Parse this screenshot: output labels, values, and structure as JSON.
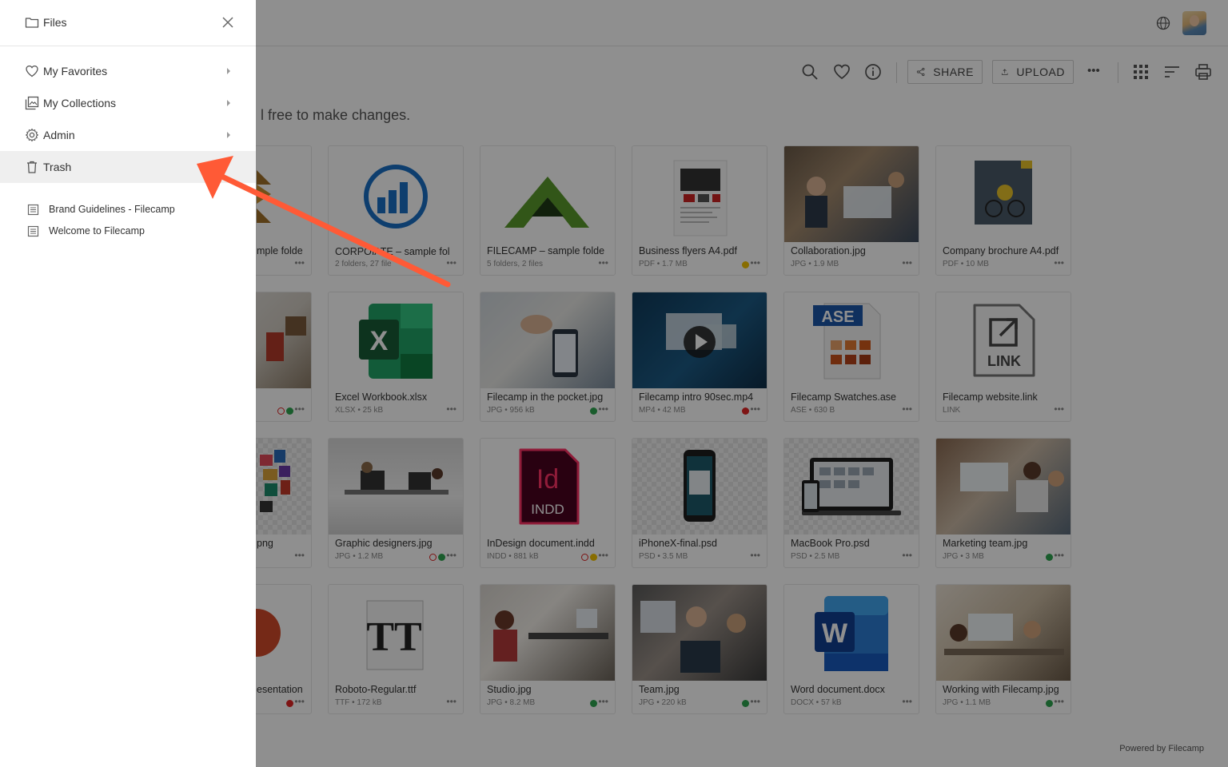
{
  "drawer": {
    "title": "Files",
    "nav": [
      {
        "label": "My Favorites",
        "icon": "heart-icon"
      },
      {
        "label": "My Collections",
        "icon": "collections-icon"
      },
      {
        "label": "Admin",
        "icon": "gear-icon"
      },
      {
        "label": "Trash",
        "icon": "trash-icon"
      }
    ],
    "links": [
      {
        "label": "Brand Guidelines - Filecamp",
        "icon": "document-icon"
      },
      {
        "label": "Welcome to Filecamp",
        "icon": "document-icon"
      }
    ]
  },
  "toolbar": {
    "share_label": "SHARE",
    "upload_label": "UPLOAD",
    "more_label": "•••"
  },
  "notice": "l free to make changes.",
  "tiles": [
    {
      "name": "mple folde",
      "meta": ""
    },
    {
      "name": "CORPOⅰATE – sample fol",
      "meta": "2 folders, 27 file"
    },
    {
      "name": "FILECAMP – sample folde",
      "meta": "5 folders, 2 files"
    },
    {
      "name": "Business flyers A4.pdf",
      "meta": "PDF • 1.7 MB"
    },
    {
      "name": "Collaboration.jpg",
      "meta": "JPG • 1.9 MB"
    },
    {
      "name": "Company brochure A4.pdf",
      "meta": "PDF • 10 MB"
    },
    {
      "name": "",
      "meta": ""
    },
    {
      "name": "Excel Workbook.xlsx",
      "meta": "XLSX • 25 kB"
    },
    {
      "name": "Filecamp in the pocket.jpg",
      "meta": "JPG • 956 kB"
    },
    {
      "name": "Filecamp intro 90sec.mp4",
      "meta": "MP4 • 42 MB"
    },
    {
      "name": "Filecamp Swatches.ase",
      "meta": "ASE • 630 B"
    },
    {
      "name": "Filecamp website.link",
      "meta": "LINK"
    },
    {
      "name": "png",
      "meta": ""
    },
    {
      "name": "Graphic designers.jpg",
      "meta": "JPG • 1.2 MB"
    },
    {
      "name": "InDesign document.indd",
      "meta": "INDD • 881 kB"
    },
    {
      "name": "iPhoneX-final.psd",
      "meta": "PSD • 3.5 MB"
    },
    {
      "name": "MacBook Pro.psd",
      "meta": "PSD • 2.5 MB"
    },
    {
      "name": "Marketing team.jpg",
      "meta": "JPG • 3 MB"
    },
    {
      "name": "esentation",
      "meta": ""
    },
    {
      "name": "Roboto-Regular.ttf",
      "meta": "TTF • 172 kB"
    },
    {
      "name": "Studio.jpg",
      "meta": "JPG • 8.2 MB"
    },
    {
      "name": "Team.jpg",
      "meta": "JPG • 220 kB"
    },
    {
      "name": "Word document.docx",
      "meta": "DOCX • 57 kB"
    },
    {
      "name": "Working with Filecamp.jpg",
      "meta": "JPG • 1.1 MB"
    }
  ],
  "thumb_text": {
    "ase": "ASE",
    "link": "LINK",
    "indd_id": "Id",
    "indd": "INDD",
    "excel": "X",
    "word": "W",
    "font": "TT"
  },
  "footer": "Powered by Filecamp",
  "colors": {
    "accent_arrow": "#ff5a36",
    "overlay": "rgba(0,0,0,0.44)",
    "tag_green": "#2ea44f",
    "tag_red": "#e02424",
    "tag_yellow": "#f2c200"
  }
}
